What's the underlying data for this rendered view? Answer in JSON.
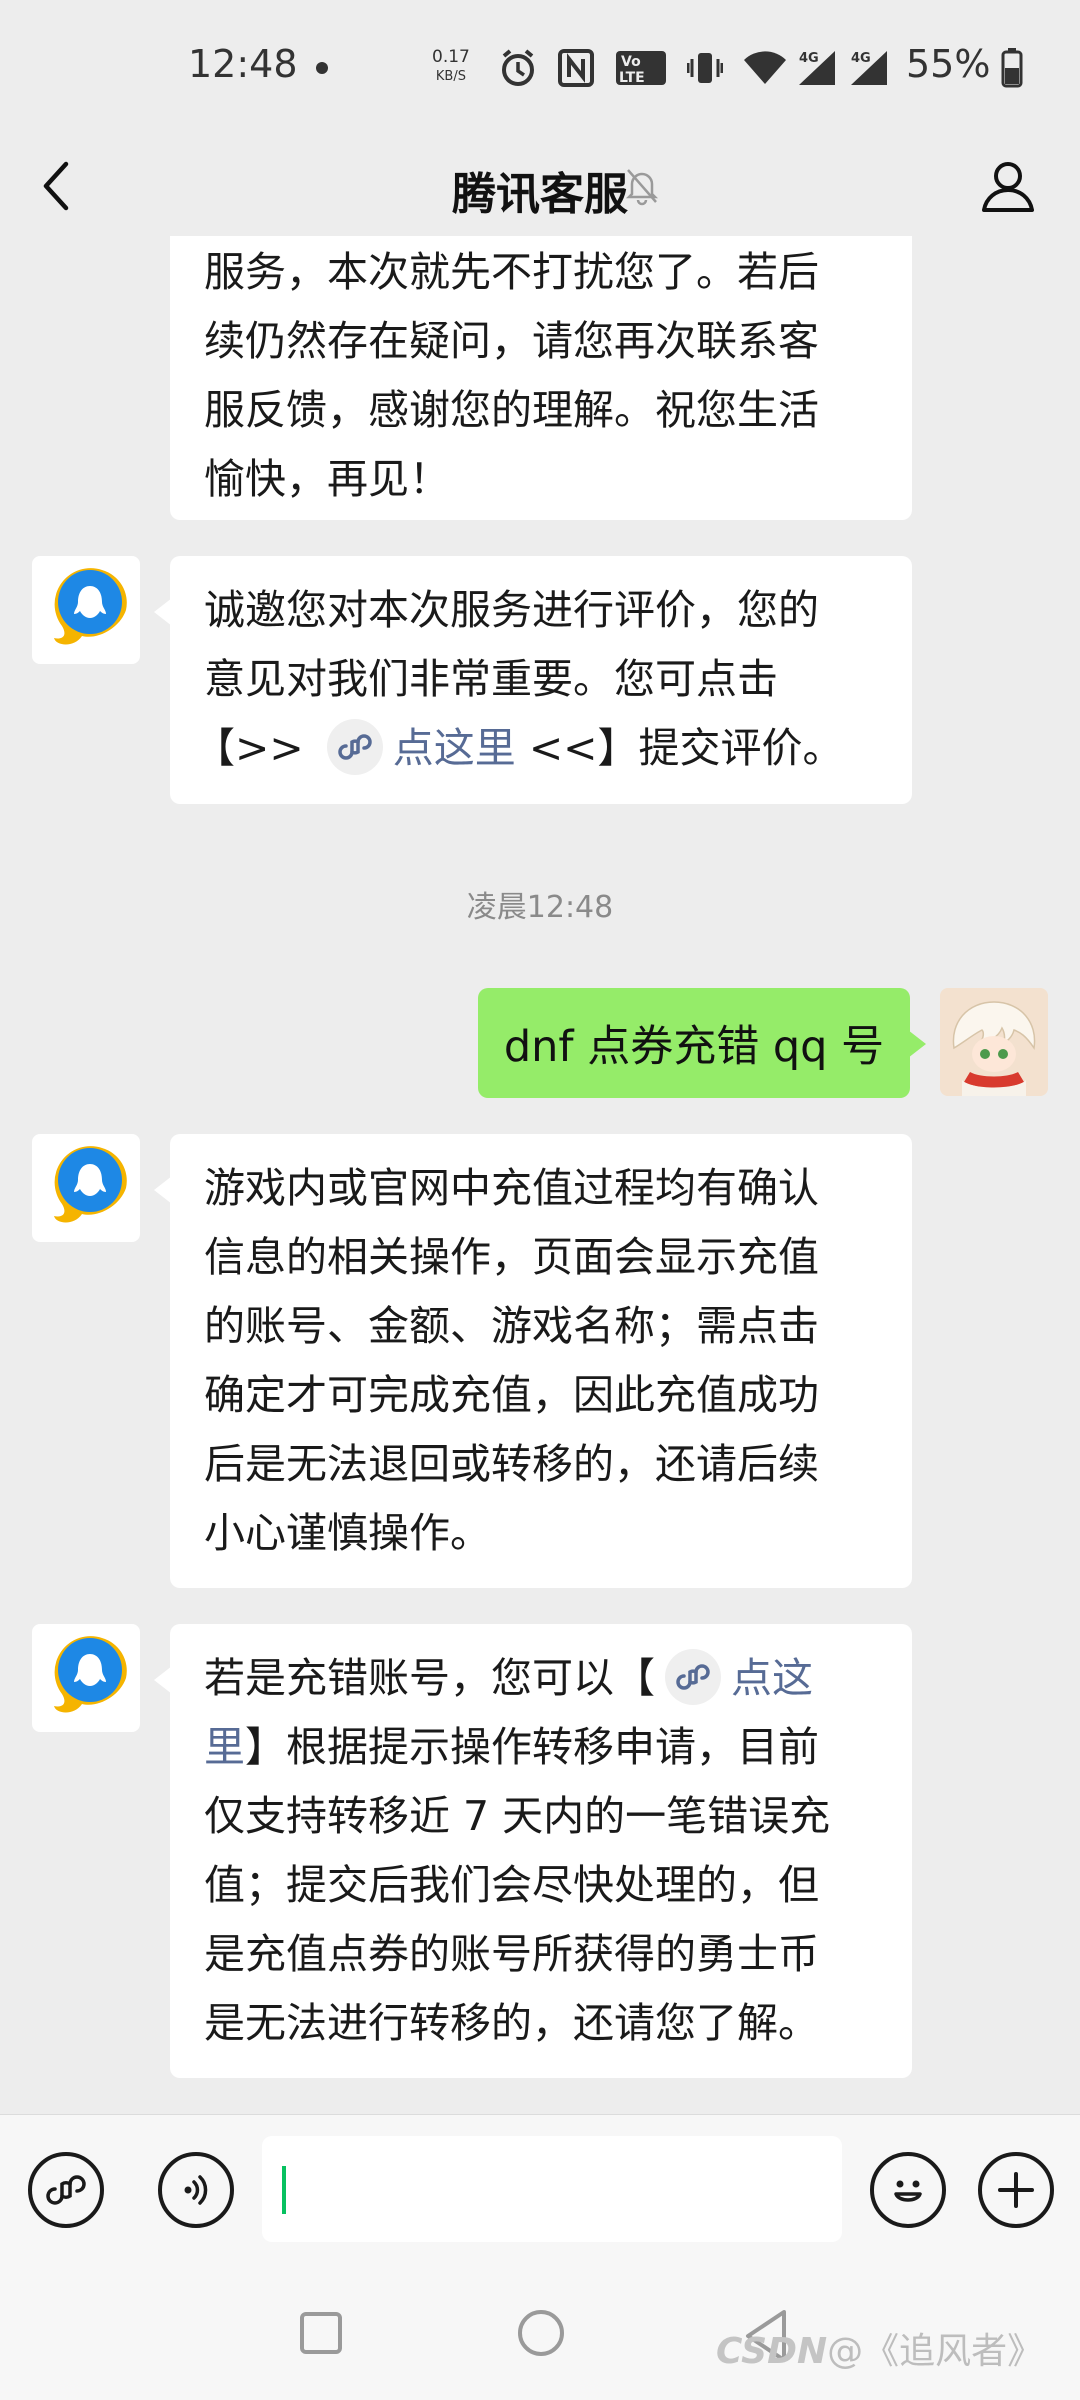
{
  "status_bar": {
    "time": "12:48",
    "speed_value": "0.17",
    "speed_unit": "KB/S",
    "lte_top": "Vo",
    "lte_bottom": "LTE",
    "signal_1": "4G",
    "signal_2": "4G",
    "battery": "55%",
    "icons": [
      "alarm-icon",
      "nfc-icon",
      "volte-icon",
      "vibrate-icon",
      "wifi-icon",
      "signal-icon",
      "signal-icon",
      "battery-icon"
    ]
  },
  "header": {
    "title": "腾讯客服",
    "icons": [
      "back-arrow-icon",
      "mute-bell-icon",
      "profile-icon"
    ]
  },
  "messages": {
    "m1": {
      "lines": [
        "服务，本次就先不打扰您了。若后",
        "续仍然存在疑问，请您再次联系客",
        "服反馈，感谢您的理解。祝您生活",
        "愉快，再见！"
      ]
    },
    "m2": {
      "line1": "诚邀您对本次服务进行评价，您的",
      "line2": "意见对我们非常重要。您可点击",
      "pre": "【>>",
      "link": "点这里",
      "post": "<<】提交评价。"
    },
    "timestamp": "凌晨12:48",
    "m3": {
      "text": "dnf 点券充错 qq 号"
    },
    "m4": {
      "lines": [
        "游戏内或官网中充值过程均有确认",
        "信息的相关操作，页面会显示充值",
        "的账号、金额、游戏名称；需点击",
        "确定才可完成充值，因此充值成功",
        "后是无法退回或转移的，还请后续",
        "小心谨慎操作。"
      ]
    },
    "m5": {
      "pre": "若是充错账号，您可以【",
      "link1": "点这",
      "link2": "里",
      "post": "】根据提示操作转移申请，目前",
      "lines": [
        "仅支持转移近 7 天内的一笔错误充",
        "值；提交后我们会尽快处理的，但",
        "是充值点券的账号所获得的勇士币",
        "是无法进行转移的，还请您了解。"
      ]
    }
  },
  "input_bar": {
    "value": "",
    "icons": [
      "mini-program-icon",
      "voice-icon",
      "emoji-icon",
      "plus-icon"
    ]
  },
  "watermark": {
    "brand": "CSDN",
    "author": "@《追风者》"
  },
  "colors": {
    "background": "#ededed",
    "outgoing_bubble": "#95ec69",
    "link": "#576b95",
    "caret": "#07c160"
  }
}
